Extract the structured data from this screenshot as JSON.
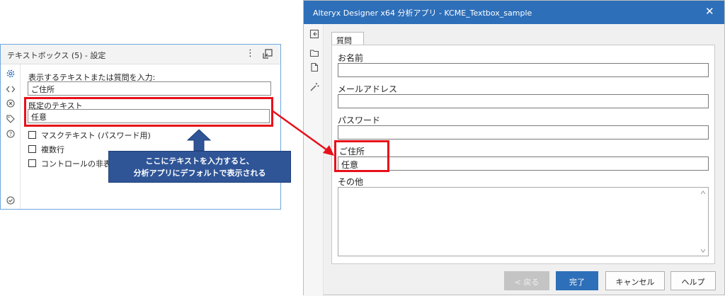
{
  "config_panel": {
    "title": "テキストボックス (5) - 設定",
    "prompt_label": "表示するテキストまたは質問を入力:",
    "prompt_value": "ご住所",
    "default_label": "既定のテキスト",
    "default_value": "任意",
    "options": [
      {
        "label": "マスクテキスト (パスワード用)",
        "checked": false
      },
      {
        "label": "複数行",
        "checked": false
      },
      {
        "label": "コントロールの非表示",
        "checked": false
      }
    ]
  },
  "callout": {
    "line1": "ここにテキストを入力すると、",
    "line2": "分析アプリにデフォルトで表示される"
  },
  "app_window": {
    "title": "Alteryx Designer x64 分析アプリ - KCME_Textbox_sample",
    "close": "✕",
    "tab_label": "質問",
    "fields": {
      "name_label": "お名前",
      "email_label": "メールアドレス",
      "password_label": "パスワード",
      "address_label": "ご住所",
      "address_value": "任意",
      "other_label": "その他"
    },
    "buttons": {
      "back": "< 戻る",
      "done": "完了",
      "cancel": "キャンセル",
      "help": "ヘルプ"
    }
  },
  "colors": {
    "highlight": "#e8101a",
    "callout_bg": "#2f5597",
    "titlebar": "#2e6fb9"
  }
}
